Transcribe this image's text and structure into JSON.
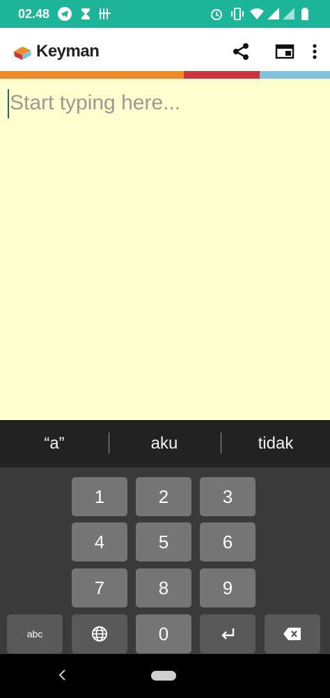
{
  "status_bar": {
    "time": "02.48",
    "left_icons": [
      "telegram-icon",
      "hourglass-icon",
      "tally-icon"
    ],
    "right_icons": [
      "alarm-icon",
      "vibrate-icon",
      "wifi-icon",
      "signal-icon",
      "signal-icon-2",
      "battery-icon"
    ]
  },
  "app_bar": {
    "brand": "Keyman",
    "actions": [
      "share-icon",
      "browser-icon",
      "overflow-menu-icon"
    ]
  },
  "accent_colors": [
    "#ef8a2b",
    "#c9353d",
    "#7fc3dc"
  ],
  "editor": {
    "placeholder": "Start typing here...",
    "background": "#fffecf"
  },
  "suggestions": [
    "“a”",
    "aku",
    "tidak"
  ],
  "keyboard": {
    "rows": [
      [
        "1",
        "2",
        "3"
      ],
      [
        "4",
        "5",
        "6"
      ],
      [
        "7",
        "8",
        "9"
      ],
      [
        "abc",
        "globe-icon",
        "0",
        "enter-icon",
        "backspace-icon"
      ]
    ],
    "labels": {
      "k1": "1",
      "k2": "2",
      "k3": "3",
      "k4": "4",
      "k5": "5",
      "k6": "6",
      "k7": "7",
      "k8": "8",
      "k9": "9",
      "k0": "0",
      "abc": "abc"
    }
  },
  "nav_bar": {
    "icons": [
      "back-icon",
      "home-pill-icon"
    ]
  }
}
